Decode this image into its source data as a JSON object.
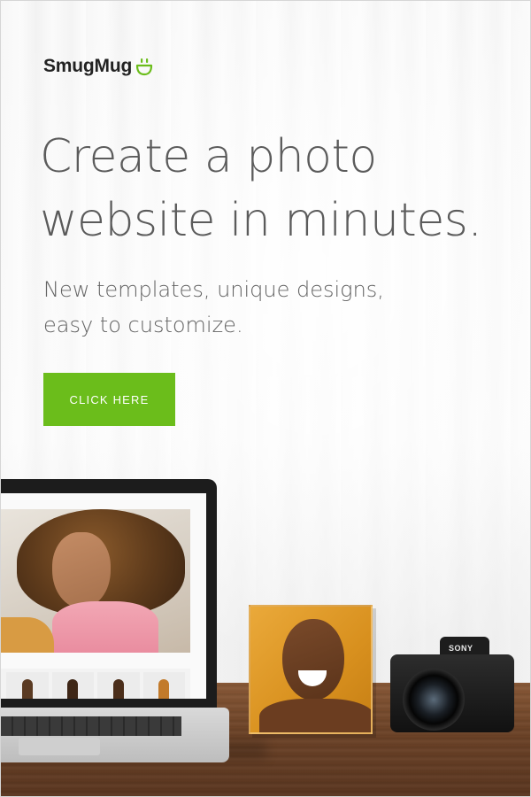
{
  "brand": {
    "name": "SmugMug",
    "accent_color": "#6bbd1b"
  },
  "headline": {
    "line1": "Create a photo",
    "line2": "website in minutes."
  },
  "subheadline": {
    "line1": "New templates, unique designs,",
    "line2": "easy to customize."
  },
  "cta": {
    "label": "CLICK HERE",
    "color": "#6bbd1b"
  },
  "scene": {
    "camera_brand": "SONY",
    "items": [
      "laptop-icon",
      "photo-block",
      "camera-icon"
    ]
  }
}
